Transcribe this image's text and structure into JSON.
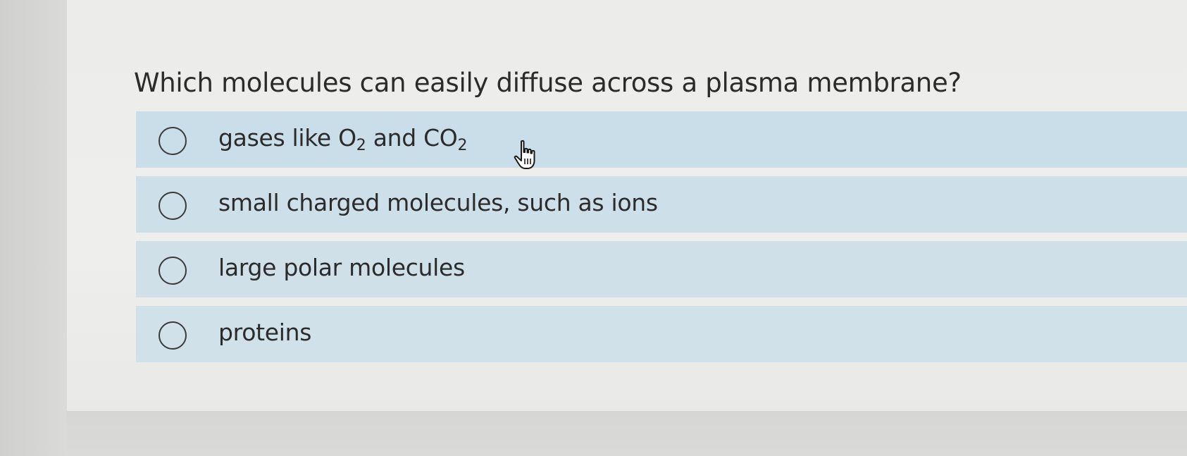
{
  "question": {
    "text": "Which molecules can easily diffuse across a plasma membrane?"
  },
  "options": [
    {
      "label_prefix": "gases like O",
      "sub1": "2",
      "label_mid": " and CO",
      "sub2": "2",
      "selected": false
    },
    {
      "label": "small charged molecules, such as ions",
      "selected": false
    },
    {
      "label": "large polar molecules",
      "selected": false
    },
    {
      "label": "proteins",
      "selected": false
    }
  ],
  "cursor": {
    "icon": "pointer-hand-icon"
  },
  "colors": {
    "option_background": "#cde0ea",
    "text": "#2b2b2b",
    "card_background": "#ececea"
  }
}
